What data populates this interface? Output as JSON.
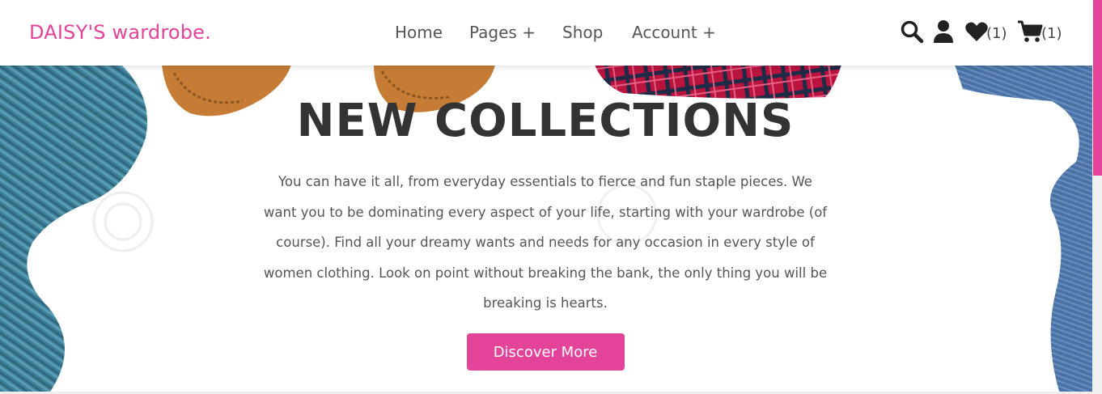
{
  "brand": {
    "name": "DAISY'S wardrobe.",
    "color": "#e4439a"
  },
  "nav": {
    "items": [
      {
        "label": "Home"
      },
      {
        "label": "Pages +"
      },
      {
        "label": "Shop"
      },
      {
        "label": "Account +"
      }
    ]
  },
  "header_icons": {
    "search_icon": "search-icon",
    "user_icon": "user-icon",
    "wishlist_icon": "heart-icon",
    "wishlist_count": "(1)",
    "cart_icon": "cart-icon",
    "cart_count": "(1)"
  },
  "hero": {
    "title": "NEW COLLECTIONS",
    "description": "You can have it all, from everyday essentials to fierce and fun staple pieces. We want you to be dominating every aspect of your life, starting with your wardrobe (of course). Find all your dreamy wants and needs for any occasion in every style of women clothing. Look on point without breaking the bank, the only thing you will be breaking is hearts.",
    "cta_label": "Discover More"
  },
  "colors": {
    "accent": "#e4439a",
    "text_dark": "#333333",
    "text_body": "#555555"
  }
}
